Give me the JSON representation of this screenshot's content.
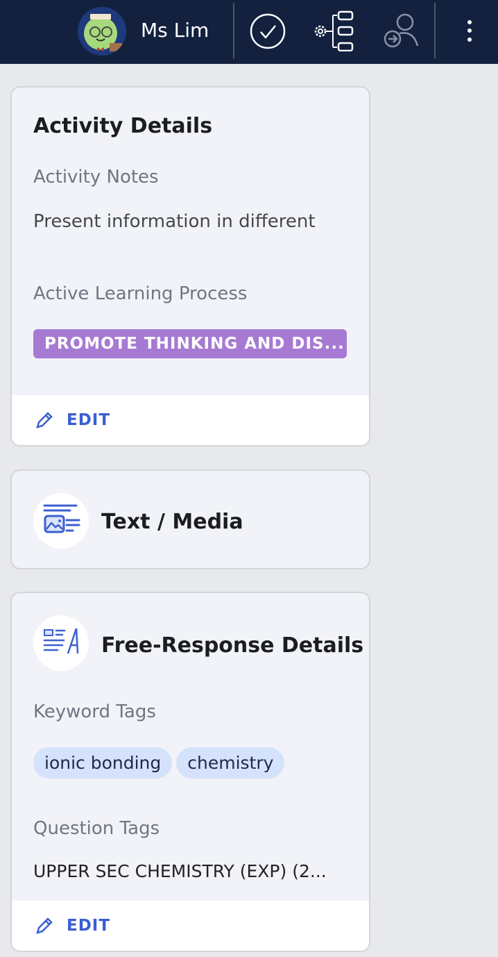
{
  "header": {
    "user_name": "Ms Lim"
  },
  "activity_details": {
    "title": "Activity Details",
    "notes_label": "Activity Notes",
    "notes_value": "Present information in different",
    "process_label": "Active Learning Process",
    "process_tag": "PROMOTE THINKING AND DIS...",
    "edit_label": "EDIT"
  },
  "text_media": {
    "title": "Text / Media"
  },
  "free_response": {
    "title": "Free-Response Details",
    "keyword_label": "Keyword Tags",
    "keywords": [
      "ionic bonding",
      "chemistry"
    ],
    "question_label": "Question Tags",
    "question_value": "UPPER SEC CHEMISTRY (EXP) (2...",
    "edit_label": "EDIT"
  }
}
